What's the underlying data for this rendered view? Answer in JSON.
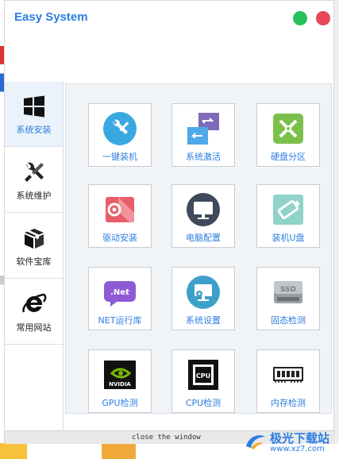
{
  "window": {
    "title": "Easy System",
    "footer_label": "close the window"
  },
  "sidebar": {
    "items": [
      {
        "label": "系统安装",
        "icon": "windows-icon",
        "active": true
      },
      {
        "label": "系统维护",
        "icon": "wrench-screwdriver-icon",
        "active": false
      },
      {
        "label": "软件宝库",
        "icon": "box-icon",
        "active": false
      },
      {
        "label": "常用网站",
        "icon": "ie-browser-icon",
        "active": false
      }
    ]
  },
  "tools": {
    "items": [
      {
        "label": "一键装机",
        "icon": "one-click-install-icon"
      },
      {
        "label": "系统激活",
        "icon": "system-activate-icon"
      },
      {
        "label": "硬盘分区",
        "icon": "disk-partition-icon"
      },
      {
        "label": "驱动安装",
        "icon": "driver-install-icon"
      },
      {
        "label": "电脑配置",
        "icon": "monitor-icon"
      },
      {
        "label": "装机U盘",
        "icon": "usb-drive-icon"
      },
      {
        "label": "NET运行库",
        "icon": "dotnet-icon"
      },
      {
        "label": "系统设置",
        "icon": "settings-monitor-icon"
      },
      {
        "label": "固态检测",
        "icon": "ssd-icon"
      },
      {
        "label": "GPU检测",
        "icon": "nvidia-icon"
      },
      {
        "label": "CPU检测",
        "icon": "cpu-icon"
      },
      {
        "label": "内存检测",
        "icon": "memory-icon"
      }
    ]
  },
  "watermark": {
    "name": "极光下载站",
    "url": "www.xz7.com"
  },
  "colors": {
    "accent": "#2c7de0",
    "close_dot": "#e8455a",
    "min_dot": "#27c25a"
  }
}
